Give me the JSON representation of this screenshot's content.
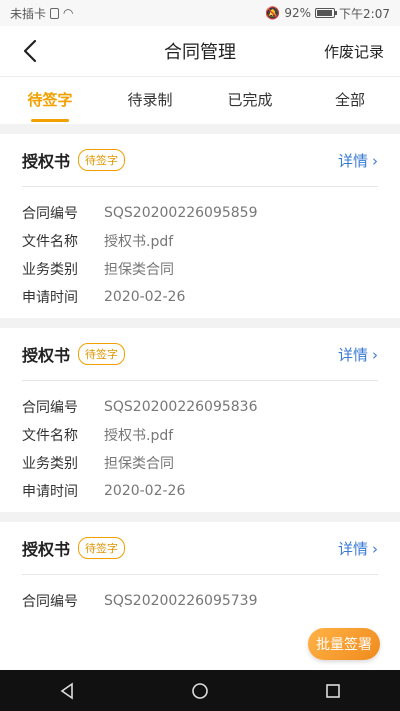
{
  "status_bar": {
    "carrier": "未插卡",
    "battery": "92%",
    "time": "下午2:07"
  },
  "nav": {
    "title": "合同管理",
    "action": "作废记录"
  },
  "tabs": [
    {
      "label": "待签字"
    },
    {
      "label": "待录制"
    },
    {
      "label": "已完成"
    },
    {
      "label": "全部"
    }
  ],
  "cards": [
    {
      "title": "授权书",
      "badge": "待签字",
      "detail": "详情",
      "rows": [
        {
          "label": "合同编号",
          "value": "SQS20200226095859"
        },
        {
          "label": "文件名称",
          "value": "授权书.pdf"
        },
        {
          "label": "业务类别",
          "value": "担保类合同"
        },
        {
          "label": "申请时间",
          "value": "2020-02-26"
        }
      ]
    },
    {
      "title": "授权书",
      "badge": "待签字",
      "detail": "详情",
      "rows": [
        {
          "label": "合同编号",
          "value": "SQS20200226095836"
        },
        {
          "label": "文件名称",
          "value": "授权书.pdf"
        },
        {
          "label": "业务类别",
          "value": "担保类合同"
        },
        {
          "label": "申请时间",
          "value": "2020-02-26"
        }
      ]
    },
    {
      "title": "授权书",
      "badge": "待签字",
      "detail": "详情",
      "rows": [
        {
          "label": "合同编号",
          "value": "SQS20200226095739"
        }
      ]
    }
  ],
  "batch_button": "批量签署",
  "colors": {
    "accent": "#f2a000",
    "link": "#3a7bd5"
  }
}
